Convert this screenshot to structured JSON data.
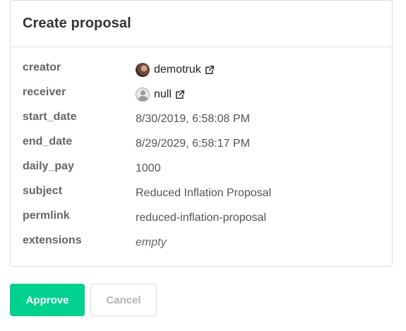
{
  "card": {
    "title": "Create proposal"
  },
  "fields": {
    "creator": {
      "key": "creator",
      "value": "demotruk"
    },
    "receiver": {
      "key": "receiver",
      "value": "null"
    },
    "start_date": {
      "key": "start_date",
      "value": "8/30/2019, 6:58:08 PM"
    },
    "end_date": {
      "key": "end_date",
      "value": "8/29/2029, 6:58:17 PM"
    },
    "daily_pay": {
      "key": "daily_pay",
      "value": "1000"
    },
    "subject": {
      "key": "subject",
      "value": "Reduced Inflation Proposal"
    },
    "permlink": {
      "key": "permlink",
      "value": "reduced-inflation-proposal"
    },
    "extensions": {
      "key": "extensions",
      "value": "empty"
    }
  },
  "actions": {
    "approve_label": "Approve",
    "cancel_label": "Cancel"
  },
  "colors": {
    "approve": "#00d18f",
    "title": "#333333",
    "key": "#666666"
  },
  "icons": {
    "external_link": "external-link-icon",
    "avatar_placeholder": "user-placeholder-icon"
  }
}
